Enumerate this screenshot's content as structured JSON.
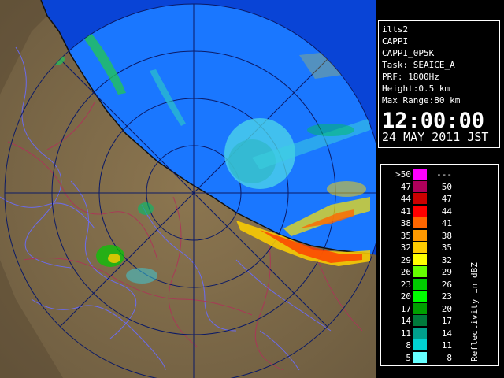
{
  "info": {
    "station": "ilts2",
    "product": "CAPPI",
    "product_id": "CAPPI_0P5K",
    "task": "Task: SEAICE_A",
    "prf": "PRF: 1800Hz",
    "height": "Height:0.5 km",
    "max_range": "Max Range:80 km",
    "time": "12:00:00",
    "date": "24 MAY 2011 JST"
  },
  "legend": {
    "unit": "Reflectivity in dBZ",
    "rows": [
      {
        "lo": ">50",
        "hi": "---",
        "color": "#ff00ff"
      },
      {
        "lo": "47",
        "hi": "50",
        "color": "#b0005a"
      },
      {
        "lo": "44",
        "hi": "47",
        "color": "#cc0000"
      },
      {
        "lo": "41",
        "hi": "44",
        "color": "#ff0000"
      },
      {
        "lo": "38",
        "hi": "41",
        "color": "#ff6600"
      },
      {
        "lo": "35",
        "hi": "38",
        "color": "#ff9900"
      },
      {
        "lo": "32",
        "hi": "35",
        "color": "#ffcc00"
      },
      {
        "lo": "29",
        "hi": "32",
        "color": "#ffff00"
      },
      {
        "lo": "26",
        "hi": "29",
        "color": "#66ff00"
      },
      {
        "lo": "23",
        "hi": "26",
        "color": "#00cc00"
      },
      {
        "lo": "20",
        "hi": "23",
        "color": "#00ff00"
      },
      {
        "lo": "17",
        "hi": "20",
        "color": "#00a000"
      },
      {
        "lo": "14",
        "hi": "17",
        "color": "#007a3c"
      },
      {
        "lo": "11",
        "hi": "14",
        "color": "#00a08c"
      },
      {
        "lo": "8",
        "hi": "11",
        "color": "#00d2d2"
      },
      {
        "lo": "5",
        "hi": "8",
        "color": "#66ffff"
      }
    ]
  },
  "colors": {
    "sea": "#0a55ff",
    "coverage": "#1e7bff",
    "land": "#8a7352",
    "ring": "#0b1a66"
  }
}
